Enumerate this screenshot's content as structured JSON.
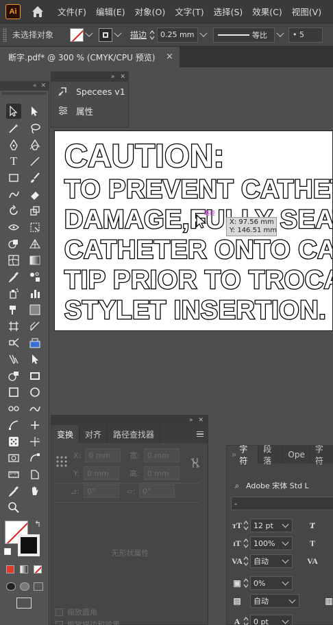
{
  "app": {
    "logo": "Ai"
  },
  "menu": [
    "文件(F)",
    "编辑(E)",
    "对象(O)",
    "文字(T)",
    "选择(S)",
    "效果(C)",
    "视图(V)"
  ],
  "control_bar": {
    "selection_status": "未选择对象",
    "stroke_label": "描边",
    "stroke_weight": "0.25 mm",
    "profile_label": "等比",
    "brush_label": "5"
  },
  "document": {
    "tab_title": "断字.pdf* @ 300 % (CMYK/CPU 预览)",
    "close_glyph": "×"
  },
  "plugin_panel": {
    "title": "Specees v1",
    "properties_label": "属性"
  },
  "artboard": {
    "lines": [
      "CAUTION:",
      "TO PREVENT CATHETER",
      "DAMAGE,FULLY SEAT",
      "CATHETER ONTO CANNULA",
      "TIP PRIOR TO TROCAR",
      "STYLET INSERTION."
    ],
    "cursor_tag": "路径",
    "coord_x": "X: 97.56 mm",
    "coord_y": "Y: 146.51 mm"
  },
  "transform_panel": {
    "tabs": [
      "变换",
      "对齐",
      "路径查找器"
    ],
    "x_label": "X:",
    "x_value": "0 mm",
    "y_label": "Y:",
    "y_value": "0 mm",
    "w_label": "宽:",
    "w_value": "0 mm",
    "h_label": "高:",
    "h_value": "0 mm",
    "angle_label": "⊿:",
    "angle_value": "0°",
    "shear_label": "▱:",
    "shear_value": "0°",
    "no_shape_text": "无形状属性",
    "scale_corners": "缩放圆角",
    "scale_strokes": "缩放描边和效果"
  },
  "character_panel": {
    "tabs": [
      "字符",
      "段落",
      "Ope",
      "字符"
    ],
    "font_family": "Adobe 宋体 Std L",
    "font_style": "-",
    "font_size": "12 pt",
    "leading": "100%",
    "kerning": "自动",
    "tracking": "0%",
    "baseline_auto": "自动",
    "baseline_shift": "0 pt"
  },
  "colors": {
    "accent_orange": "#f39a1d",
    "panel_bg": "#535353",
    "menubar_bg": "#3a3a3a",
    "cursor_tag": "#c02bd6"
  }
}
